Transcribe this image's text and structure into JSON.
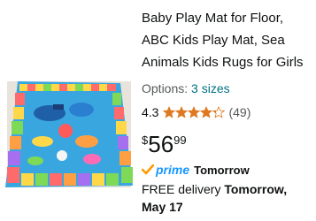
{
  "product": {
    "title": "Baby Play Mat for Floor, ABC Kids Play Mat, Sea Animals Kids Rugs for Girls",
    "image_alt": "Sea animals ABC play mat on floor",
    "options_label": "Options:",
    "options_value": "3 sizes",
    "rating_value": "4.3",
    "rating_stars": 4.3,
    "rating_count": "(49)",
    "price_symbol": "$",
    "price_whole": "56",
    "price_fraction": "99",
    "prime_word": "prime",
    "prime_delivery": "Tomorrow",
    "delivery_prefix": "FREE delivery",
    "delivery_date": "Tomorrow, May 17"
  },
  "colors": {
    "star": "#de7921",
    "link": "#007185",
    "prime_blue": "#1a98ff",
    "prime_check": "#ff9900"
  },
  "icons": {
    "rating": "star-icon",
    "prime": "prime-check-icon"
  }
}
